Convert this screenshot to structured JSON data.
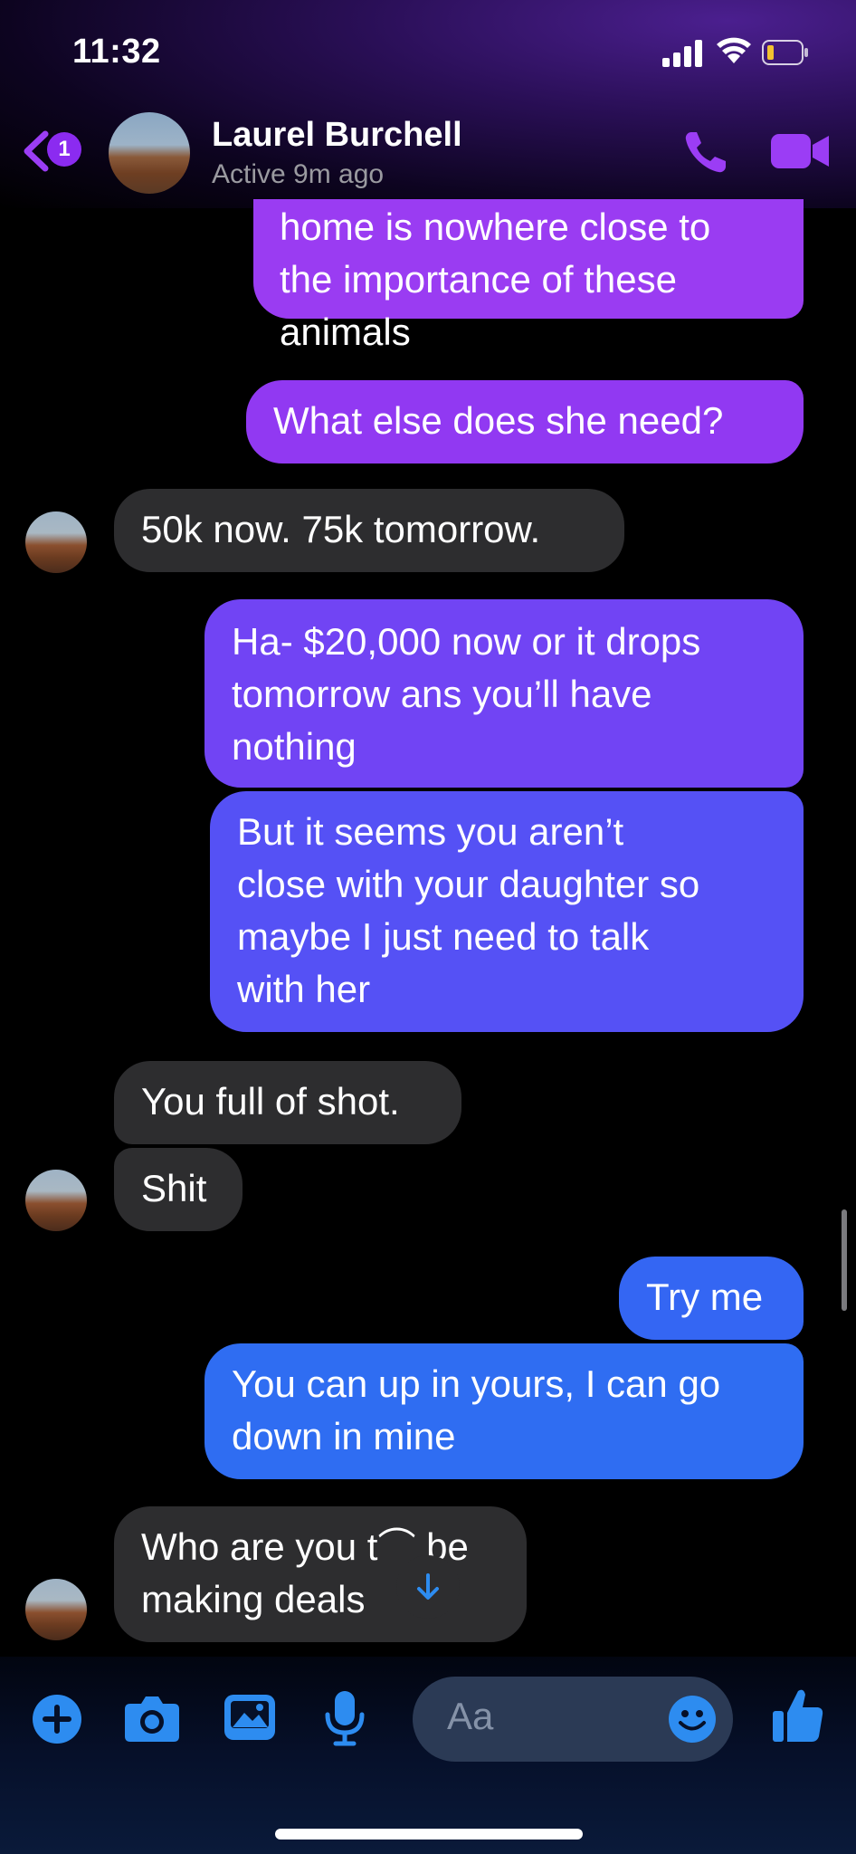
{
  "status_bar": {
    "time": "11:32"
  },
  "header": {
    "back_badge": "1",
    "contact_name": "Laurel Burchell",
    "contact_status": "Active 9m ago"
  },
  "messages": [
    {
      "from": "me",
      "text": "home is nowhere close to\nthe importance of these\nanimals"
    },
    {
      "from": "me",
      "text": "What else does she need?"
    },
    {
      "from": "them",
      "text": "50k now. 75k tomorrow."
    },
    {
      "from": "me",
      "text": "Ha- $20,000 now or it drops\ntomorrow ans you’ll have\nnothing"
    },
    {
      "from": "me",
      "text": "But it seems you aren’t\nclose with your daughter so\nmaybe I just need to talk\nwith her"
    },
    {
      "from": "them",
      "text": "You full of shot."
    },
    {
      "from": "them",
      "text": "Shit"
    },
    {
      "from": "me",
      "text": "Try me"
    },
    {
      "from": "me",
      "text": "You can up in yours, I can go\ndown in mine"
    },
    {
      "from": "them",
      "text": "Who are you t⌒ be\nmaking deals"
    }
  ],
  "composer": {
    "placeholder": "Aa"
  },
  "icons": [
    "back-arrow-icon",
    "phone-icon",
    "video-camera-icon",
    "plus-icon",
    "camera-icon",
    "gallery-icon",
    "microphone-icon",
    "emoji-icon",
    "thumbs-up-icon",
    "arrow-down-icon"
  ],
  "colors": {
    "outgoing_top": "#9a3cf2",
    "outgoing_mid": "#6a4ef5",
    "outgoing_bottom": "#2f6df2",
    "incoming": "#2d2d2f",
    "accent_blue": "#2d8cf0"
  }
}
